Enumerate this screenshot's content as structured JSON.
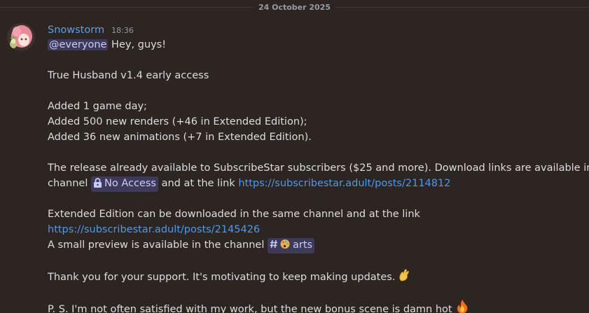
{
  "divider": {
    "date": "24 October 2025"
  },
  "message": {
    "author": "Snowstorm",
    "timestamp": "18:36",
    "mention": "@everyone",
    "greeting": " Hey, guys!",
    "title_line": "True Husband v1.4 early access",
    "changes": [
      "Added 1 game day;",
      "Added 500 new renders (+46 in Extended Edition);",
      "Added 36 new animations (+7 in Extended Edition)."
    ],
    "release_line1": "The release already available to SubscribeStar subscribers ($25 and more). Download links are available in the",
    "release_line2_prefix": "channel ",
    "no_access_channel": "No Access",
    "release_line2_mid": "  and at the link ",
    "release_link": "https://subscribestar.adult/posts/2114812",
    "extended_line": "Extended Edition can be downloaded in the same channel and at the link",
    "extended_link": "https://subscribestar.adult/posts/2145426",
    "preview_prefix": "A small preview is available in the channel ",
    "arts_channel": "arts",
    "thanks_line": "Thank you for your support. It's motivating to keep making updates.",
    "ps_line": "P. S. I'm not often satisfied with my work, but the new bonus scene is damn hot"
  },
  "icons": {
    "no_access": "lock-icon",
    "arts": "hash-palette-icon",
    "thanks": "crossed-fingers-emoji",
    "ps": "fire-emoji"
  }
}
